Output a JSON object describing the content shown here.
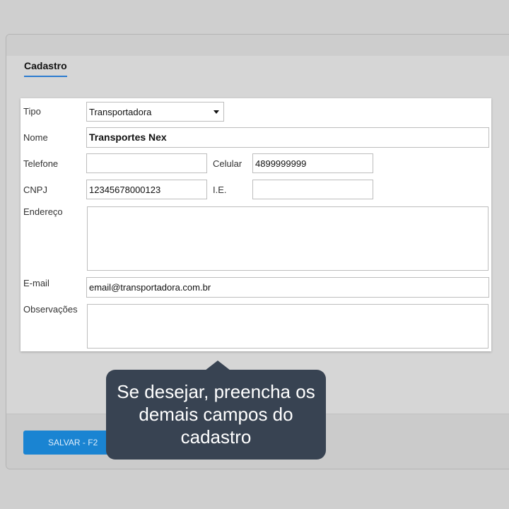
{
  "tab": {
    "label": "Cadastro"
  },
  "form": {
    "tipo": {
      "label": "Tipo",
      "value": "Transportadora"
    },
    "nome": {
      "label": "Nome",
      "value": "Transportes Nex"
    },
    "telefone": {
      "label": "Telefone",
      "value": ""
    },
    "celular": {
      "label": "Celular",
      "value": "4899999999"
    },
    "cnpj": {
      "label": "CNPJ",
      "value": "12345678000123"
    },
    "ie": {
      "label": "I.E.",
      "value": ""
    },
    "endereco": {
      "label": "Endereço",
      "value": ""
    },
    "email": {
      "label": "E-mail",
      "value": "email@transportadora.com.br"
    },
    "observacoes": {
      "label": "Observações",
      "value": ""
    }
  },
  "footer": {
    "save_label": "SALVAR - F2"
  },
  "tooltip": {
    "text": "Se desejar, preencha os demais campos do cadastro"
  },
  "colors": {
    "accent": "#1a84d2",
    "tooltip_bg": "#384352"
  }
}
